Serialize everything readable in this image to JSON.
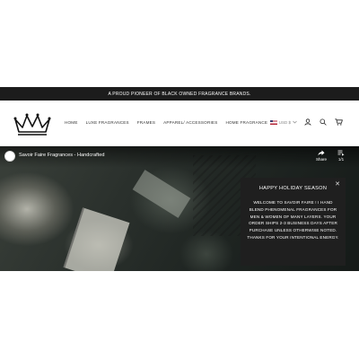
{
  "announcement": "A PROUD PIONEER OF BLACK OWNED FRAGRANCE BRANDS.",
  "nav": {
    "items": [
      "HOME",
      "LUXE FRAGRANCES",
      "FRAMES",
      "APPAREL/ ACCESSORIES",
      "HOME FRAGRANCE"
    ]
  },
  "header": {
    "currency": "USD $",
    "icons": [
      "account-icon",
      "search-icon",
      "cart-icon"
    ]
  },
  "video": {
    "title": "Savoir Faire Fragrances - Handcrafted",
    "share_label": "Share",
    "playlist_count": "1/1"
  },
  "popup": {
    "title": "HAPPY HOLIDAY SEASON",
    "body": "WELCOME TO SAVOIR FAIRE ! I HAND BLEND PHENOMENAL FRAGRANCES FOR MEN & WOMEN OF MANY LAYERS. YOUR ORDER SHIPS 2-3 BUSINESS DAYS AFTER PURCHASE UNLESS OTHERWISE NOTED. THANKS FOR YOUR INTENTIONAL ENERGY.",
    "close_icon": "close-icon"
  },
  "colors": {
    "announcement_bg": "#1c1c1c",
    "popup_bg": "#1f1f1f",
    "text_dark": "#333333"
  }
}
